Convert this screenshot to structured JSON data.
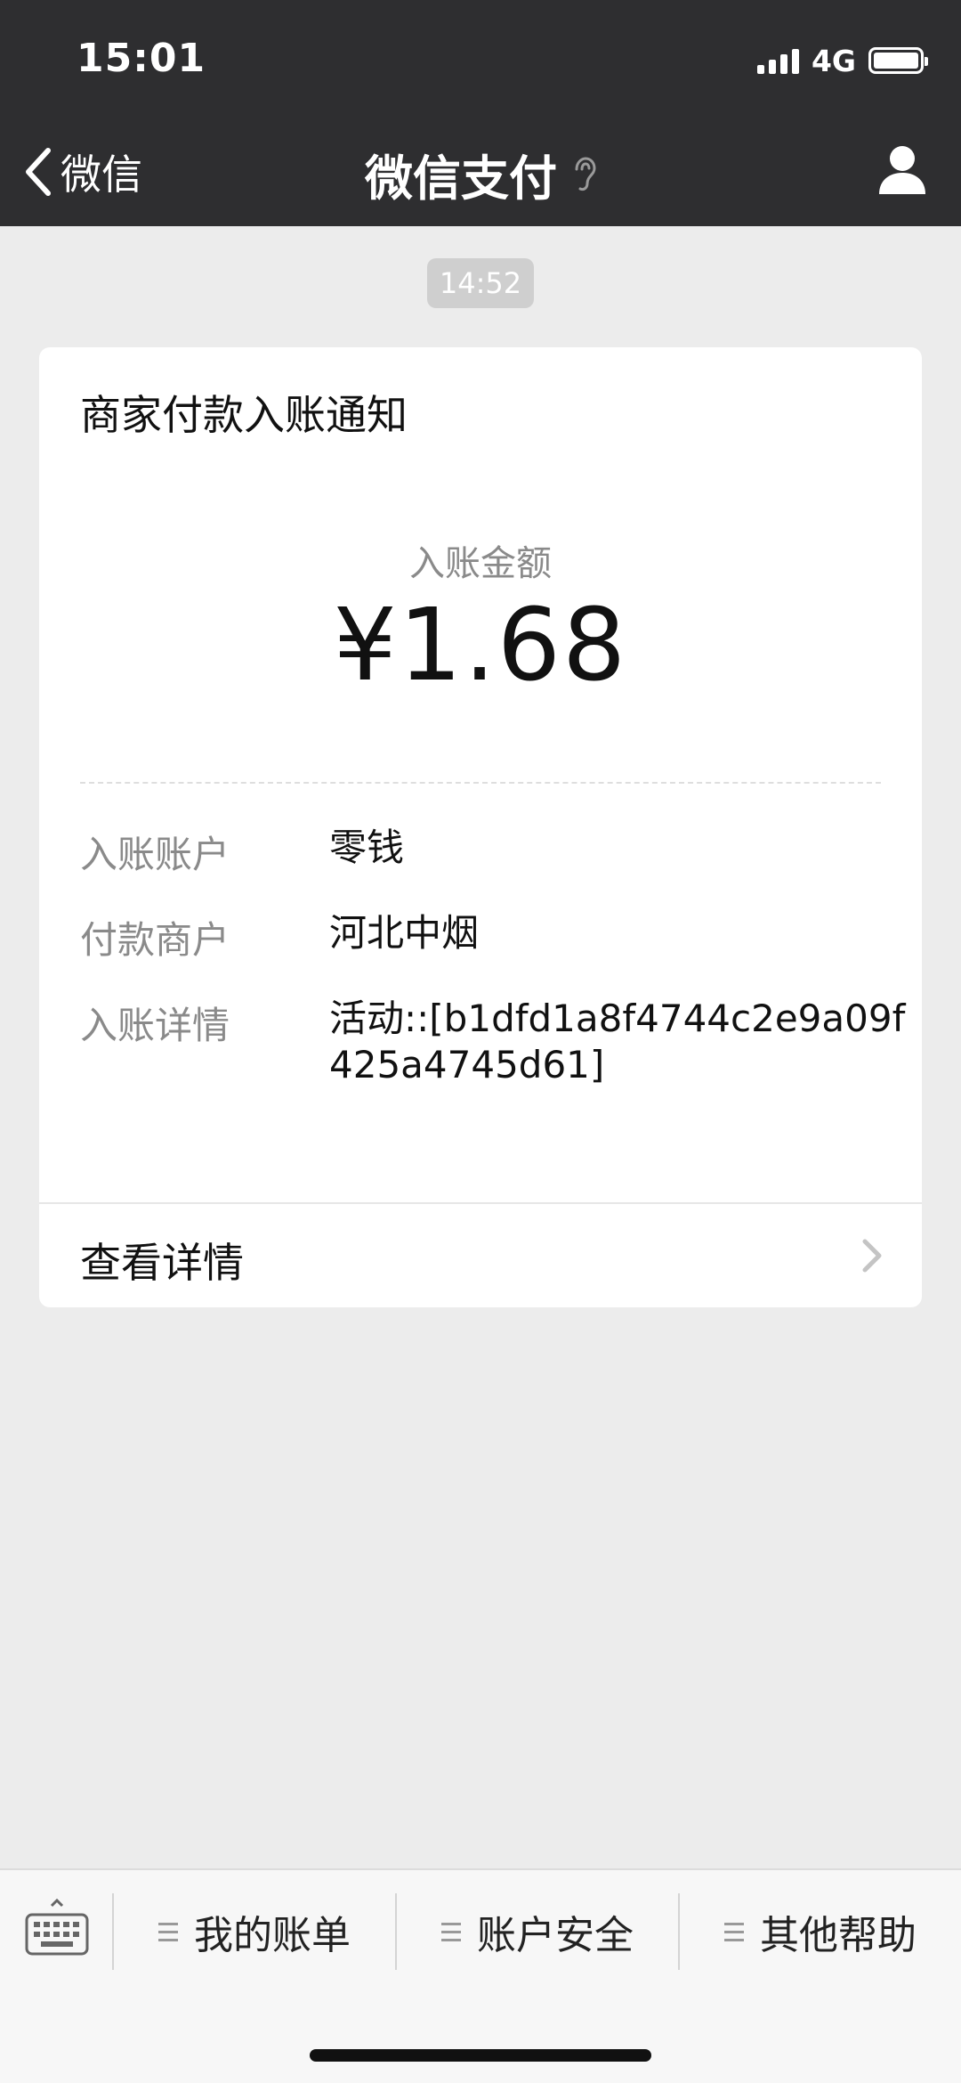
{
  "status_bar": {
    "time": "15:01",
    "network": "4G"
  },
  "nav": {
    "back_label": "微信",
    "title": "微信支付"
  },
  "message": {
    "timestamp": "14:52",
    "card": {
      "title": "商家付款入账通知",
      "amount_label": "入账金额",
      "amount": "¥1.68",
      "details": [
        {
          "label": "入账账户",
          "value": "零钱"
        },
        {
          "label": "付款商户",
          "value": "河北中烟"
        },
        {
          "label": "入账详情",
          "value": "活动::[b1dfd1a8f4744c2e9a09f425a4745d61]"
        }
      ],
      "view_details_label": "查看详情"
    }
  },
  "bottom_menu": {
    "items": [
      {
        "label": "我的账单"
      },
      {
        "label": "账户安全"
      },
      {
        "label": "其他帮助"
      }
    ]
  },
  "colors": {
    "nav_background": "#2e2e30",
    "page_background": "#ececec",
    "card_background": "#ffffff",
    "secondary_text": "#8a8a8a"
  },
  "icons": [
    "back-chevron-icon",
    "ear-icon",
    "user-icon",
    "chevron-right-icon",
    "keyboard-icon",
    "menu-lines-icon"
  ]
}
